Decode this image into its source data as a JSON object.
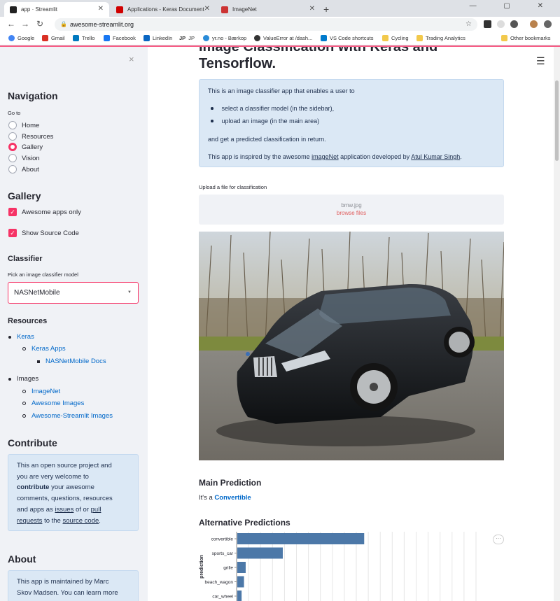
{
  "browser": {
    "tabs": [
      {
        "label": "app · Streamlit",
        "active": true,
        "favicon_color": "#222222"
      },
      {
        "label": "Applications - Keras Documentati",
        "active": false,
        "favicon_color": "#d00000"
      },
      {
        "label": "ImageNet",
        "active": false,
        "favicon_color": "#cc3333"
      }
    ],
    "new_tab": "+",
    "window_controls": "— ▢ ✕",
    "url": "awesome-streamlit.org",
    "bookmarks": [
      {
        "label": "Google",
        "color": "#4285f4"
      },
      {
        "label": "Gmail",
        "color": "#d93025"
      },
      {
        "label": "Trello",
        "color": "#0079bf"
      },
      {
        "label": "Facebook",
        "color": "#1877f2"
      },
      {
        "label": "LinkedIn",
        "color": "#0a66c2"
      },
      {
        "label": "JP",
        "color": "#222222"
      },
      {
        "label": "yr.no - Bærkop",
        "color": "#2a8bd8"
      },
      {
        "label": "ValueError at /dash...",
        "color": "#333333"
      },
      {
        "label": "VS Code shortcuts",
        "color": "#007acc"
      },
      {
        "label": "Cycling",
        "color": "#f2c94c"
      },
      {
        "label": "Trading Analytics",
        "color": "#f2c94c"
      },
      {
        "label": "Other bookmarks",
        "color": "#f2c94c"
      }
    ]
  },
  "sidebar": {
    "close": "×",
    "navigation_title": "Navigation",
    "goto_label": "Go to",
    "nav_options": [
      "Home",
      "Resources",
      "Gallery",
      "Vision",
      "About"
    ],
    "nav_selected": "Gallery",
    "gallery_title": "Gallery",
    "checkboxes": [
      "Awesome apps only",
      "Show Source Code"
    ],
    "classifier_title": "Classifier",
    "classifier_label": "Pick an image classifier model",
    "classifier_value": "NASNetMobile",
    "resources_title": "Resources",
    "resources": {
      "keras": "Keras",
      "keras_apps": "Keras Apps",
      "nasnet_docs": "NASNetMobile Docs",
      "images": "Images",
      "imagenet": "ImageNet",
      "awesome_images": "Awesome Images",
      "awesome_streamlit_images": "Awesome-Streamlit Images"
    },
    "contribute_title": "Contribute",
    "contribute": {
      "l1": "This an open source project and",
      "l2": "you are very welcome to",
      "l3a": "contribute",
      "l3b": " your awesome",
      "l4": "comments, questions, resources",
      "l5a": "and apps as ",
      "l5b": "issues",
      "l5c": " of or ",
      "l5d": "pull",
      "l6a": "requests",
      "l6b": " to the ",
      "l6c": "source code",
      "l6d": "."
    },
    "about_title": "About",
    "about": {
      "l1": "This app is maintained by Marc",
      "l2": "Skov Madsen. You can learn more"
    }
  },
  "main": {
    "title_line1": "Image Classification with Keras and",
    "title_line2": "Tensorflow.",
    "intro": {
      "p1": "This is an image classifier app that enables a user to",
      "bullet1": "select a classifier model (in the sidebar),",
      "bullet2": "upload an image (in the main area)",
      "p2": "and get a predicted classification in return.",
      "p3a": "This app is inspired by the awesome ",
      "p3b": "imageNet",
      "p3c": " application developed by ",
      "p3d": "Atul Kumar Singh",
      "p3e": "."
    },
    "upload_label": "Upload a file for classification",
    "uploaded_file": "bmw.jpg",
    "browse_label": "browse files",
    "main_prediction_title": "Main Prediction",
    "prediction_prefix": "It's a ",
    "prediction_value": "Convertible",
    "alt_predictions_title": "Alternative Predictions",
    "chart_menu": "···"
  },
  "chart_data": {
    "type": "bar",
    "orientation": "horizontal",
    "categories": [
      "convertible",
      "sports_car",
      "grille",
      "beach_wagon",
      "car_wheel"
    ],
    "values": [
      0.53,
      0.19,
      0.035,
      0.028,
      0.018
    ],
    "ylabel": "prediction",
    "xlim": [
      0,
      1
    ],
    "bar_color": "#4c78a8",
    "grid": true
  }
}
